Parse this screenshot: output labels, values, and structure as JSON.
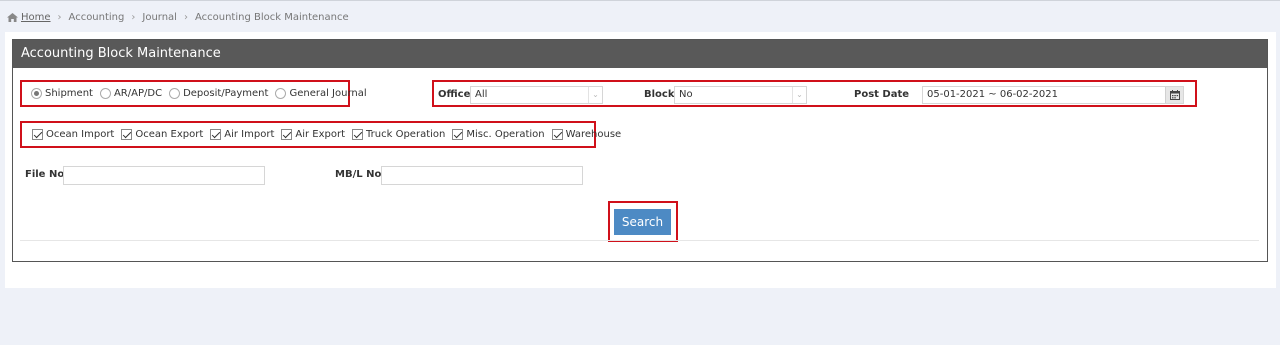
{
  "breadcrumb": {
    "home": "Home",
    "accounting": "Accounting",
    "journal": "Journal",
    "current": "Accounting Block Maintenance"
  },
  "panel": {
    "title": "Accounting Block Maintenance"
  },
  "radios": {
    "shipment": "Shipment",
    "arapdc": "AR/AP/DC",
    "deposit": "Deposit/Payment",
    "general": "General Journal",
    "selected": "Shipment"
  },
  "filters": {
    "office_label": "Office",
    "office_value": "All",
    "block_label": "Block",
    "block_value": "No",
    "post_date_label": "Post Date",
    "post_date_value": "05-01-2021 ~ 06-02-2021"
  },
  "checkboxes": {
    "ocean_import": "Ocean Import",
    "ocean_export": "Ocean Export",
    "air_import": "Air Import",
    "air_export": "Air Export",
    "truck_operation": "Truck Operation",
    "misc_operation": "Misc. Operation",
    "warehouse": "Warehouse"
  },
  "fields": {
    "file_no_label": "File No.",
    "file_no_value": "",
    "mbl_no_label": "MB/L No.",
    "mbl_no_value": ""
  },
  "actions": {
    "search": "Search"
  },
  "icons": {
    "home": "home-icon",
    "calendar": "calendar-icon",
    "chevron": "chevron-down-icon"
  },
  "colors": {
    "header_bg": "#595959",
    "highlight": "#d0101a",
    "button": "#4d8ac4",
    "page_bg": "#eef1f8"
  }
}
